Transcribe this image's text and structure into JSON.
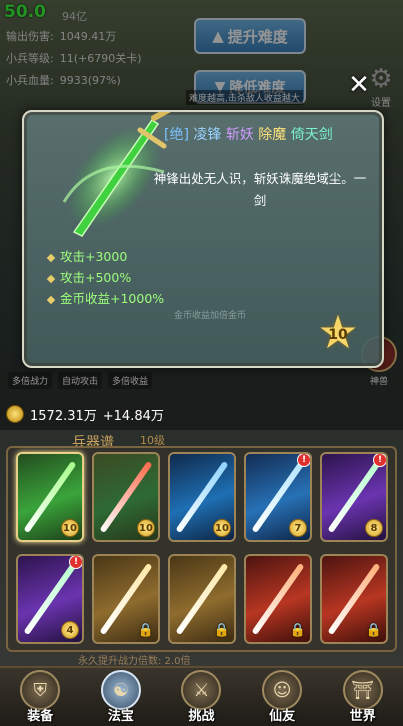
{
  "fps": {
    "value": "50.0",
    "sub": "94亿"
  },
  "stats": [
    {
      "label": "输出伤害:",
      "value": "1049.41万"
    },
    {
      "label": "小兵等级:",
      "value": "11(+6790关卡)"
    },
    {
      "label": "小兵血量:",
      "value": "9933(97%)"
    }
  ],
  "buttons": {
    "upgrade": "提升难度",
    "downgrade": "降低难度",
    "hint": "难度越高,击杀敌人收益越大"
  },
  "settings_label": "设置",
  "mini_tags": [
    "多倍战力",
    "自动攻击",
    "多倍收益"
  ],
  "side_icon_label": "神兽",
  "gold": {
    "amount": "1572.31万",
    "increment": "+14.84万"
  },
  "section": {
    "title": "兵器谱",
    "sub": "10级"
  },
  "permanent_text": "永久提升战力倍数: 2.0倍",
  "modal": {
    "tier": "[绝]",
    "name_parts": [
      "凌锋",
      "斩妖",
      "除魔",
      "倚天剑"
    ],
    "description": "神锋出处无人识，斩妖诛魔绝域尘。一剑",
    "bonuses": [
      "攻击+3000",
      "攻击+500%",
      "金币收益+1000%"
    ],
    "level": "10",
    "ghost_hint": "金币收益加倍金币"
  },
  "weapons": [
    {
      "name": "sword-1",
      "theme": "green",
      "level": "10",
      "locked": false,
      "alert": false
    },
    {
      "name": "sword-2",
      "theme": "red",
      "level": "10",
      "locked": false,
      "alert": false
    },
    {
      "name": "sword-3",
      "theme": "blue",
      "level": "10",
      "locked": false,
      "alert": false
    },
    {
      "name": "sword-4",
      "theme": "blue2",
      "level": "7",
      "locked": false,
      "alert": true
    },
    {
      "name": "sword-5",
      "theme": "purple",
      "level": "8",
      "locked": false,
      "alert": true
    },
    {
      "name": "sword-6",
      "theme": "purple",
      "level": "4",
      "locked": false,
      "alert": true
    },
    {
      "name": "sword-7",
      "theme": "gold",
      "level": "",
      "locked": true,
      "alert": false
    },
    {
      "name": "sword-8",
      "theme": "gold",
      "level": "",
      "locked": true,
      "alert": false
    },
    {
      "name": "sword-9",
      "theme": "orange",
      "level": "",
      "locked": true,
      "alert": false
    },
    {
      "name": "sword-10",
      "theme": "orange",
      "level": "",
      "locked": true,
      "alert": false
    }
  ],
  "nav": [
    {
      "label": "装备",
      "icon": "armor-icon",
      "active": false
    },
    {
      "label": "法宝",
      "icon": "bagua-icon",
      "active": true
    },
    {
      "label": "挑战",
      "icon": "crossed-swords-icon",
      "active": false
    },
    {
      "label": "仙友",
      "icon": "companion-icon",
      "active": false
    },
    {
      "label": "世界",
      "icon": "pagoda-icon",
      "active": false
    }
  ]
}
